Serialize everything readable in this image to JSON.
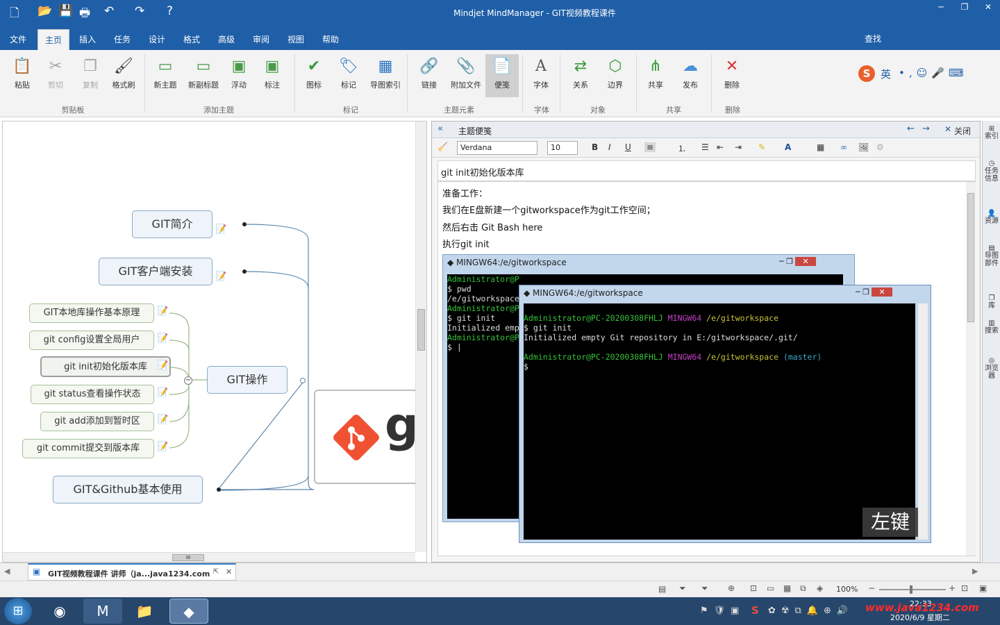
{
  "window": {
    "title": "Mindjet MindManager - GIT视频教程课件",
    "min": "─",
    "restore": "❐",
    "close": "✕"
  },
  "qat": {
    "icons": [
      "new-icon",
      "open-icon",
      "save-icon",
      "print-icon",
      "undo-icon",
      "redo-icon",
      "help-icon"
    ]
  },
  "menu": {
    "items": [
      "文件",
      "主页",
      "插入",
      "任务",
      "设计",
      "格式",
      "高级",
      "审阅",
      "视图",
      "帮助"
    ],
    "active": "主页",
    "find": "查找"
  },
  "ribbon": {
    "buttons": [
      {
        "label": "粘贴",
        "icon": "📋"
      },
      {
        "label": "剪切",
        "icon": "✂"
      },
      {
        "label": "复制",
        "icon": "❐"
      },
      {
        "label": "格式刷",
        "icon": "🖌"
      },
      {
        "label": "新主题",
        "icon": "▭"
      },
      {
        "label": "新副标题",
        "icon": "▭"
      },
      {
        "label": "浮动",
        "icon": "▣"
      },
      {
        "label": "标注",
        "icon": "▣"
      },
      {
        "label": "图标",
        "icon": "✔"
      },
      {
        "label": "标记",
        "icon": "🏷"
      },
      {
        "label": "导图索引",
        "icon": "▦"
      },
      {
        "label": "链接",
        "icon": "🔗"
      },
      {
        "label": "附加文件",
        "icon": "📎"
      },
      {
        "label": "便笺",
        "icon": "📄"
      },
      {
        "label": "字体",
        "icon": "A"
      },
      {
        "label": "关系",
        "icon": "⇄"
      },
      {
        "label": "边界",
        "icon": "⬡"
      },
      {
        "label": "共享",
        "icon": "⋔"
      },
      {
        "label": "发布",
        "icon": "☁"
      },
      {
        "label": "删除",
        "icon": "✕"
      }
    ],
    "groups": [
      "剪贴板",
      "添加主题",
      "标记",
      "主题元素",
      "字体",
      "对象",
      "共享",
      "删除"
    ]
  },
  "ime": {
    "text": "英"
  },
  "mindmap": {
    "main_topics": [
      "GIT简介",
      "GIT客户端安装",
      "GIT操作",
      "GIT&Github基本使用"
    ],
    "sub_topics": [
      "GIT本地库操作基本原理",
      "git config设置全局用户",
      "git init初始化版本库",
      "git status查看操作状态",
      "git add添加到暂时区",
      "git commit提交到版本库"
    ],
    "image_text": "g",
    "scroll_thumb": "III"
  },
  "notes": {
    "header": "主题便笺",
    "close": "关闭",
    "font": "Verdana",
    "size": "10",
    "format_buttons": [
      "B",
      "I",
      "U"
    ],
    "title": "git init初始化版本库",
    "lines": [
      "准备工作：",
      "我们在E盘新建一个gitworkspace作为git工作空间；",
      "然后右击 Git Bash here",
      "执行git init"
    ]
  },
  "terminal_back": {
    "title": "MINGW64:/e/gitworkspace",
    "lines": [
      "Administrator@P",
      "$ pwd",
      "/e/gitworkspace",
      "",
      "Administrator@P",
      "$ git init",
      "Initialized emp",
      "",
      "Administrator@P",
      "$ |"
    ]
  },
  "terminal_front": {
    "title": "MINGW64:/e/gitworkspace",
    "user": "Administrator@PC-20200308FHLJ",
    "env": "MINGW64",
    "path": "/e/gitworkspace",
    "cmd": "$ git init",
    "out": "Initialized empty Git repository in E:/gitworkspace/.git/",
    "branch": "(master)",
    "prompt": "$"
  },
  "overlay": {
    "left_click": "左键"
  },
  "rightbar": {
    "items": [
      "索引",
      "任务信息",
      "资源",
      "导图部件",
      "库",
      "搜索",
      "浏览器"
    ]
  },
  "tabbar": {
    "doc_tab": "GIT视频教程课件 讲师（ja...java1234.com"
  },
  "status": {
    "zoom": "100%"
  },
  "taskbar": {
    "time": "22:33",
    "date": "2020/6/9 星期二",
    "watermark": "www.java1234.com"
  }
}
